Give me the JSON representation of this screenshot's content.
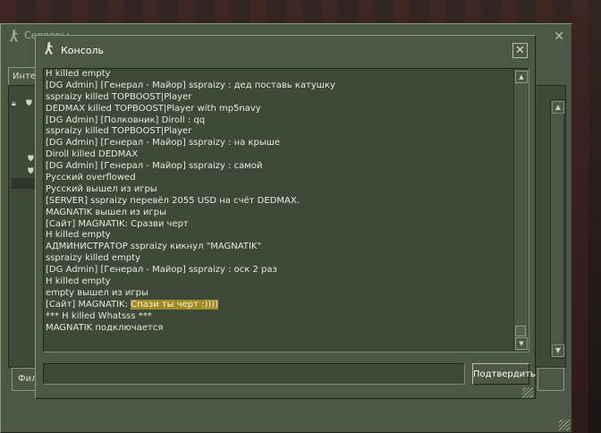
{
  "servers_window": {
    "title": "Серверы",
    "tab_label": "Интер",
    "bottom_button_label": "Фил"
  },
  "console": {
    "title": "Консоль",
    "log_lines": [
      "H killed empty",
      "[DG Admin] [Генерал - Майор] sspraizy : дед поставь катушку",
      "sspraizy killed TOPBOOST|Player",
      "DEDMAX killed TOPBOOST|Player with mp5navy",
      "[DG Admin] [Полковник] Diroll : qq",
      "sspraizy killed TOPBOOST|Player",
      "[DG Admin] [Генерал - Майор] sspraizy : на крыше",
      "Diroll killed DEDMAX",
      "[DG Admin] [Генерал - Майор] sspraizy : самой",
      "Русский overflowed",
      "Русский вышел из игры",
      "[SERVER] sspraizy перевёл 2055 USD на счёт DEDMAX.",
      "MAGNATIK вышел из игры",
      "[Сайт] MAGNATIK: Сразви черт",
      "H killed empty",
      "АДМИНИСТРАТОР sspraizy кикнул \"MAGNATIK\"",
      "sspraizy killed empty",
      "[DG Admin] [Генерал - Майор] sspraizy : оск 2 раз",
      "H killed empty",
      "empty вышел из игры"
    ],
    "highlight_line": {
      "prefix": "[Сайт] MAGNATIK: ",
      "highlighted": "Спази ты черт :))))"
    },
    "log_lines_after": [
      "*** H killed Whatsss ***",
      "MAGNATIK подключается"
    ],
    "command_input_value": "",
    "submit_label": "Подтвердить"
  },
  "colors": {
    "panel": "#4c5844",
    "panel_dark": "#3e4937",
    "highlight": "#a08a2a",
    "text": "#e6e9df"
  }
}
